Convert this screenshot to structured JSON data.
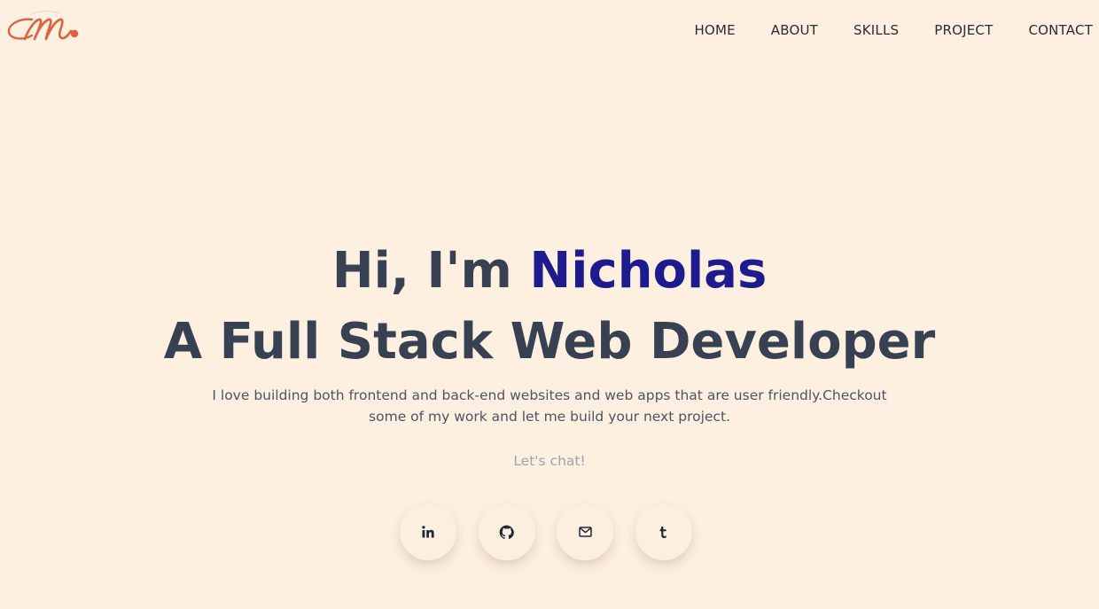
{
  "header": {
    "logo_icon": "monogram-m-logo",
    "nav": [
      {
        "label": "HOME"
      },
      {
        "label": "ABOUT"
      },
      {
        "label": "SKILLS"
      },
      {
        "label": "PROJECT"
      },
      {
        "label": "CONTACT"
      }
    ]
  },
  "hero": {
    "greeting_prefix": "Hi, I'm ",
    "name": "Nicholas",
    "role": "A Full Stack Web Developer",
    "bio": "I love building both frontend and back-end websites and web apps that are user friendly.Checkout some of my work and let me build your next project.",
    "cta": "Let's chat!"
  },
  "socials": [
    {
      "icon": "linkedin-icon"
    },
    {
      "icon": "github-icon"
    },
    {
      "icon": "mail-icon"
    },
    {
      "icon": "tumblr-icon"
    }
  ],
  "colors": {
    "background": "#fef0e1",
    "heading": "#374151",
    "accent_name": "#1e1b8f",
    "logo": "#d9643f"
  }
}
